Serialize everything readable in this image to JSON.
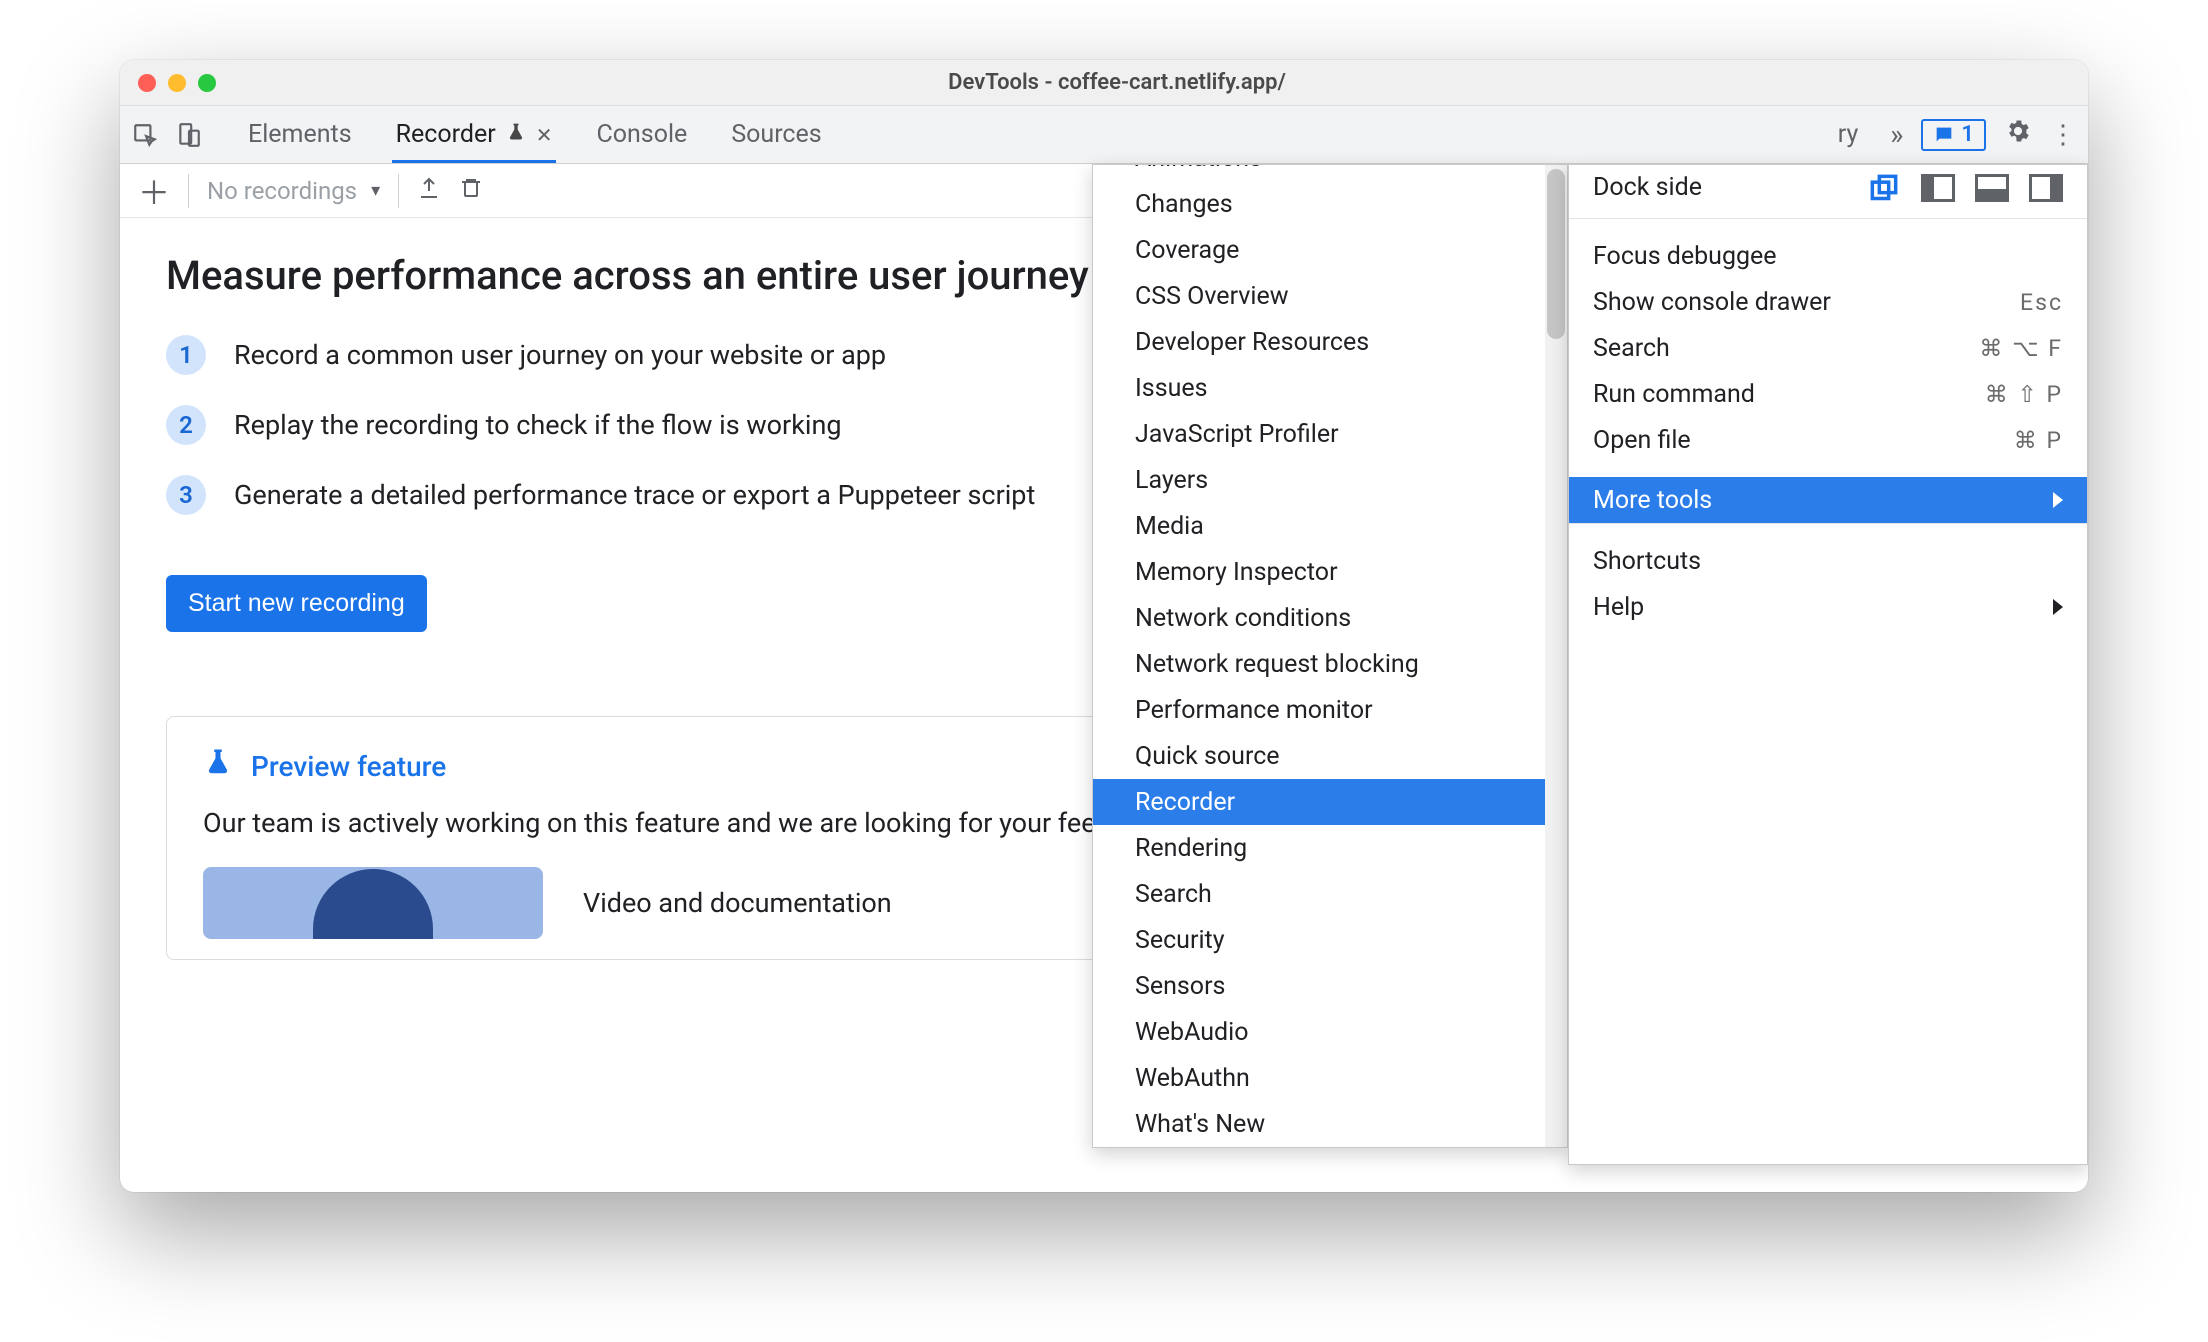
{
  "window_title": "DevTools - coffee-cart.netlify.app/",
  "tabstrip": {
    "tabs": [
      "Elements",
      "Recorder",
      "Console",
      "Sources"
    ],
    "active": "Recorder",
    "hidden_tab_hint": "ry",
    "message_count": "1"
  },
  "recorder_toolbar": {
    "dropdown_label": "No recordings"
  },
  "page": {
    "title": "Measure performance across an entire user journey",
    "steps": [
      "Record a common user journey on your website or app",
      "Replay the recording to check if the flow is working",
      "Generate a detailed performance trace or export a Puppeteer script"
    ],
    "start_button": "Start new recording",
    "preview_heading": "Preview feature",
    "preview_text": "Our team is actively working on this feature and we are looking for your feedback!",
    "preview_video_label": "Video and documentation"
  },
  "main_menu": {
    "dock_label": "Dock side",
    "items_a": [
      {
        "label": "Focus debuggee",
        "shortcut": ""
      },
      {
        "label": "Show console drawer",
        "shortcut": "Esc"
      },
      {
        "label": "Search",
        "shortcut": "⌘ ⌥ F"
      },
      {
        "label": "Run command",
        "shortcut": "⌘ ⇧ P"
      },
      {
        "label": "Open file",
        "shortcut": "⌘ P"
      }
    ],
    "more_tools": "More tools",
    "items_b": [
      {
        "label": "Shortcuts",
        "arrow": false
      },
      {
        "label": "Help",
        "arrow": true
      }
    ]
  },
  "more_tools_menu": {
    "items": [
      "Animations",
      "Changes",
      "Coverage",
      "CSS Overview",
      "Developer Resources",
      "Issues",
      "JavaScript Profiler",
      "Layers",
      "Media",
      "Memory Inspector",
      "Network conditions",
      "Network request blocking",
      "Performance monitor",
      "Quick source",
      "Recorder",
      "Rendering",
      "Search",
      "Security",
      "Sensors",
      "WebAudio",
      "WebAuthn",
      "What's New"
    ],
    "selected": "Recorder"
  }
}
